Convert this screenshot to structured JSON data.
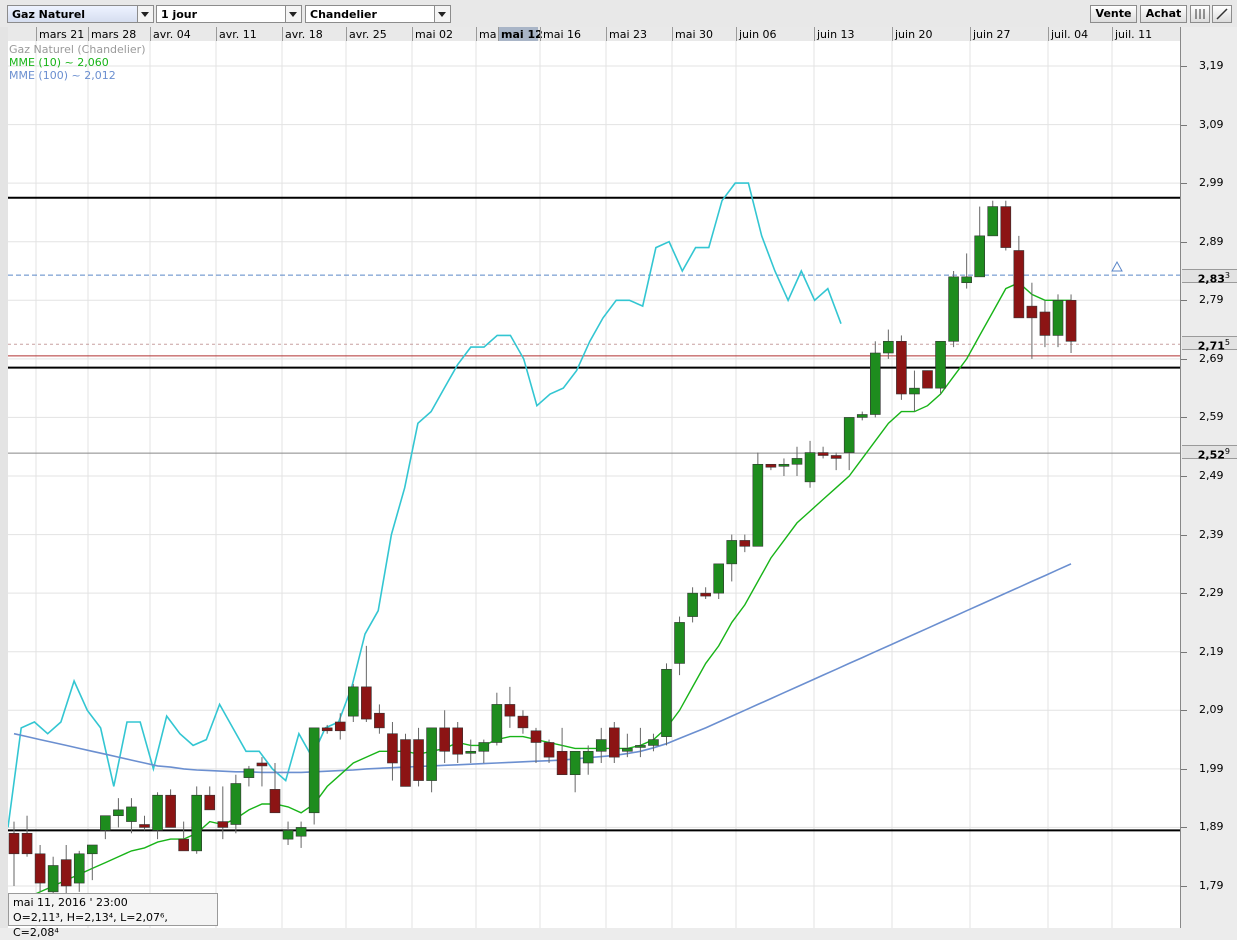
{
  "toolbar": {
    "instrument": "Gaz Naturel",
    "period": "1 jour",
    "chart_type": "Chandelier",
    "sell_label": "Vente",
    "buy_label": "Achat"
  },
  "date_labels": [
    "mars 21",
    "mars 28",
    "avr. 04",
    "avr. 11",
    "avr. 18",
    "avr. 25",
    "mai 02",
    "ma",
    "mai 12",
    "mai 16",
    "mai 23",
    "mai 30",
    "juin 06",
    "juin 13",
    "juin 20",
    "juin 27",
    "juil. 04",
    "juil. 11"
  ],
  "legend": {
    "title": "Gaz Naturel (Chandelier)",
    "ema10": "MME (10) ~ 2,060",
    "ema100": "MME (100) ~ 2,012"
  },
  "price_boxes": {
    "upper": "2,83",
    "upper_frac": "3",
    "current": "2,71",
    "current_frac": "5",
    "lower": "2,52",
    "lower_frac": "9"
  },
  "info": {
    "date": "mai 11, 2016 ' 23:00",
    "ohlc": "O=2,11³, H=2,13⁴, L=2,07⁶, C=2,08⁴"
  },
  "colors": {
    "up": "#1e8c1e",
    "down": "#8c1414",
    "ema10": "#18b418",
    "ema100": "#6b8fd0",
    "oscillator": "#33c6d2"
  },
  "chart_data": {
    "type": "candlestick",
    "title": "Gaz Naturel (Chandelier)",
    "ylim": [
      1.75,
      3.24
    ],
    "y_ticks": [
      3.19,
      3.09,
      2.99,
      2.89,
      2.79,
      2.69,
      2.59,
      2.49,
      2.39,
      2.29,
      2.19,
      2.09,
      1.99,
      1.89,
      1.79
    ],
    "y_tick_labels": [
      "3,19",
      "3,09",
      "2,99",
      "2,89",
      "2,79",
      "2,69",
      "2,59",
      "2,49",
      "2,39",
      "2,29",
      "2,19",
      "2,09",
      "1,99",
      "1,89",
      "1,79"
    ],
    "horizontal_lines": [
      2.965,
      2.675,
      1.885
    ],
    "dashed_line": 2.833,
    "candles": [
      {
        "o": 1.88,
        "h": 1.9,
        "l": 1.79,
        "c": 1.845
      },
      {
        "o": 1.88,
        "h": 1.91,
        "l": 1.84,
        "c": 1.845
      },
      {
        "o": 1.845,
        "h": 1.86,
        "l": 1.78,
        "c": 1.795
      },
      {
        "o": 1.78,
        "h": 1.84,
        "l": 1.765,
        "c": 1.825
      },
      {
        "o": 1.835,
        "h": 1.86,
        "l": 1.77,
        "c": 1.79
      },
      {
        "o": 1.795,
        "h": 1.85,
        "l": 1.78,
        "c": 1.845
      },
      {
        "o": 1.845,
        "h": 1.86,
        "l": 1.8,
        "c": 1.86
      },
      {
        "o": 1.885,
        "h": 1.91,
        "l": 1.87,
        "c": 1.91
      },
      {
        "o": 1.91,
        "h": 1.94,
        "l": 1.89,
        "c": 1.92
      },
      {
        "o": 1.9,
        "h": 1.94,
        "l": 1.88,
        "c": 1.925
      },
      {
        "o": 1.895,
        "h": 1.91,
        "l": 1.885,
        "c": 1.89
      },
      {
        "o": 1.885,
        "h": 1.95,
        "l": 1.87,
        "c": 1.945
      },
      {
        "o": 1.945,
        "h": 1.955,
        "l": 1.9,
        "c": 1.89
      },
      {
        "o": 1.87,
        "h": 1.9,
        "l": 1.855,
        "c": 1.85
      },
      {
        "o": 1.85,
        "h": 1.96,
        "l": 1.845,
        "c": 1.945
      },
      {
        "o": 1.945,
        "h": 1.96,
        "l": 1.93,
        "c": 1.92
      },
      {
        "o": 1.9,
        "h": 1.96,
        "l": 1.87,
        "c": 1.89
      },
      {
        "o": 1.895,
        "h": 1.98,
        "l": 1.88,
        "c": 1.965
      },
      {
        "o": 1.975,
        "h": 1.995,
        "l": 1.96,
        "c": 1.99
      },
      {
        "o": 2.0,
        "h": 2.01,
        "l": 1.96,
        "c": 1.995
      },
      {
        "o": 1.955,
        "h": 2.0,
        "l": 1.92,
        "c": 1.915
      },
      {
        "o": 1.87,
        "h": 1.9,
        "l": 1.86,
        "c": 1.885
      },
      {
        "o": 1.875,
        "h": 1.9,
        "l": 1.855,
        "c": 1.89
      },
      {
        "o": 1.915,
        "h": 2.005,
        "l": 1.895,
        "c": 2.06
      },
      {
        "o": 2.06,
        "h": 2.065,
        "l": 2.05,
        "c": 2.055
      },
      {
        "o": 2.07,
        "h": 2.085,
        "l": 2.04,
        "c": 2.055
      },
      {
        "o": 2.08,
        "h": 2.135,
        "l": 2.07,
        "c": 2.13
      },
      {
        "o": 2.13,
        "h": 2.2,
        "l": 2.07,
        "c": 2.075
      },
      {
        "o": 2.085,
        "h": 2.1,
        "l": 2.05,
        "c": 2.06
      },
      {
        "o": 2.05,
        "h": 2.07,
        "l": 1.97,
        "c": 2.0
      },
      {
        "o": 2.04,
        "h": 2.05,
        "l": 1.96,
        "c": 1.96
      },
      {
        "o": 2.04,
        "h": 2.06,
        "l": 1.96,
        "c": 1.97
      },
      {
        "o": 1.97,
        "h": 2.04,
        "l": 1.95,
        "c": 2.06
      },
      {
        "o": 2.06,
        "h": 2.09,
        "l": 2.0,
        "c": 2.02
      },
      {
        "o": 2.06,
        "h": 2.07,
        "l": 2.0,
        "c": 2.015
      },
      {
        "o": 2.02,
        "h": 2.04,
        "l": 2.0,
        "c": 2.02
      },
      {
        "o": 2.02,
        "h": 2.04,
        "l": 2.0,
        "c": 2.035
      },
      {
        "o": 2.035,
        "h": 2.12,
        "l": 2.03,
        "c": 2.1
      },
      {
        "o": 2.1,
        "h": 2.13,
        "l": 2.06,
        "c": 2.08
      },
      {
        "o": 2.08,
        "h": 2.09,
        "l": 2.05,
        "c": 2.06
      },
      {
        "o": 2.055,
        "h": 2.06,
        "l": 2.0,
        "c": 2.035
      },
      {
        "o": 2.035,
        "h": 2.04,
        "l": 2.0,
        "c": 2.01
      },
      {
        "o": 2.02,
        "h": 2.06,
        "l": 1.99,
        "c": 1.98
      },
      {
        "o": 1.98,
        "h": 2.02,
        "l": 1.95,
        "c": 2.02
      },
      {
        "o": 2.0,
        "h": 2.03,
        "l": 1.98,
        "c": 2.02
      },
      {
        "o": 2.02,
        "h": 2.06,
        "l": 2.0,
        "c": 2.04
      },
      {
        "o": 2.06,
        "h": 2.07,
        "l": 2.0,
        "c": 2.01
      },
      {
        "o": 2.02,
        "h": 2.05,
        "l": 2.01,
        "c": 2.025
      },
      {
        "o": 2.03,
        "h": 2.06,
        "l": 2.01,
        "c": 2.03
      },
      {
        "o": 2.03,
        "h": 2.05,
        "l": 2.02,
        "c": 2.04
      },
      {
        "o": 2.045,
        "h": 2.17,
        "l": 2.03,
        "c": 2.16
      },
      {
        "o": 2.17,
        "h": 2.25,
        "l": 2.15,
        "c": 2.24
      },
      {
        "o": 2.25,
        "h": 2.3,
        "l": 2.24,
        "c": 2.29
      },
      {
        "o": 2.29,
        "h": 2.3,
        "l": 2.28,
        "c": 2.285
      },
      {
        "o": 2.29,
        "h": 2.34,
        "l": 2.28,
        "c": 2.34
      },
      {
        "o": 2.34,
        "h": 2.39,
        "l": 2.31,
        "c": 2.38
      },
      {
        "o": 2.38,
        "h": 2.39,
        "l": 2.36,
        "c": 2.37
      },
      {
        "o": 2.37,
        "h": 2.53,
        "l": 2.37,
        "c": 2.51
      },
      {
        "o": 2.51,
        "h": 2.51,
        "l": 2.5,
        "c": 2.505
      },
      {
        "o": 2.51,
        "h": 2.52,
        "l": 2.49,
        "c": 2.51
      },
      {
        "o": 2.51,
        "h": 2.54,
        "l": 2.49,
        "c": 2.52
      },
      {
        "o": 2.48,
        "h": 2.55,
        "l": 2.47,
        "c": 2.53
      },
      {
        "o": 2.53,
        "h": 2.54,
        "l": 2.52,
        "c": 2.525
      },
      {
        "o": 2.525,
        "h": 2.53,
        "l": 2.5,
        "c": 2.52
      },
      {
        "o": 2.53,
        "h": 2.59,
        "l": 2.5,
        "c": 2.59
      },
      {
        "o": 2.59,
        "h": 2.6,
        "l": 2.585,
        "c": 2.595
      },
      {
        "o": 2.595,
        "h": 2.72,
        "l": 2.59,
        "c": 2.7
      },
      {
        "o": 2.7,
        "h": 2.74,
        "l": 2.69,
        "c": 2.72
      },
      {
        "o": 2.72,
        "h": 2.73,
        "l": 2.62,
        "c": 2.63
      },
      {
        "o": 2.63,
        "h": 2.67,
        "l": 2.6,
        "c": 2.64
      },
      {
        "o": 2.67,
        "h": 2.67,
        "l": 2.64,
        "c": 2.64
      },
      {
        "o": 2.64,
        "h": 2.72,
        "l": 2.63,
        "c": 2.72
      },
      {
        "o": 2.72,
        "h": 2.84,
        "l": 2.71,
        "c": 2.83
      },
      {
        "o": 2.82,
        "h": 2.87,
        "l": 2.81,
        "c": 2.83
      },
      {
        "o": 2.83,
        "h": 2.95,
        "l": 2.83,
        "c": 2.9
      },
      {
        "o": 2.9,
        "h": 2.96,
        "l": 2.9,
        "c": 2.95
      },
      {
        "o": 2.95,
        "h": 2.96,
        "l": 2.875,
        "c": 2.88
      },
      {
        "o": 2.875,
        "h": 2.9,
        "l": 2.78,
        "c": 2.76
      },
      {
        "o": 2.78,
        "h": 2.82,
        "l": 2.69,
        "c": 2.76
      },
      {
        "o": 2.77,
        "h": 2.79,
        "l": 2.71,
        "c": 2.73
      },
      {
        "o": 2.73,
        "h": 2.8,
        "l": 2.71,
        "c": 2.79
      },
      {
        "o": 2.79,
        "h": 2.8,
        "l": 2.7,
        "c": 2.72
      }
    ],
    "ema10": [
      1.76,
      1.77,
      1.78,
      1.79,
      1.8,
      1.81,
      1.82,
      1.83,
      1.84,
      1.85,
      1.855,
      1.865,
      1.87,
      1.87,
      1.88,
      1.9,
      1.895,
      1.905,
      1.92,
      1.93,
      1.93,
      1.925,
      1.915,
      1.93,
      1.96,
      1.98,
      2.0,
      2.01,
      2.02,
      2.02,
      2.02,
      2.015,
      2.02,
      2.025,
      2.035,
      2.03,
      2.03,
      2.04,
      2.045,
      2.045,
      2.04,
      2.035,
      2.03,
      2.025,
      2.025,
      2.025,
      2.025,
      2.025,
      2.03,
      2.04,
      2.06,
      2.09,
      2.13,
      2.17,
      2.2,
      2.24,
      2.27,
      2.31,
      2.35,
      2.38,
      2.41,
      2.43,
      2.45,
      2.47,
      2.49,
      2.52,
      2.55,
      2.58,
      2.6,
      2.6,
      2.61,
      2.63,
      2.66,
      2.69,
      2.73,
      2.77,
      2.81,
      2.82,
      2.8,
      2.79,
      2.79,
      2.79
    ],
    "ema100": [
      2.05,
      2.045,
      2.04,
      2.035,
      2.03,
      2.025,
      2.02,
      2.015,
      2.01,
      2.005,
      2.0,
      1.995,
      1.993,
      1.99,
      1.988,
      1.987,
      1.986,
      1.985,
      1.985,
      1.984,
      1.984,
      1.984,
      1.984,
      1.985,
      1.986,
      1.987,
      1.988,
      1.99,
      1.991,
      1.992,
      1.993,
      1.994,
      1.995,
      1.996,
      1.997,
      1.998,
      1.999,
      2.0,
      2.001,
      2.002,
      2.003,
      2.004,
      2.005,
      2.007,
      2.009,
      2.011,
      2.013,
      2.016,
      2.02,
      2.026,
      2.033,
      2.042,
      2.051,
      2.06,
      2.07,
      2.08,
      2.09,
      2.1,
      2.11,
      2.12,
      2.13,
      2.14,
      2.15,
      2.16,
      2.17,
      2.18,
      2.19,
      2.2,
      2.21,
      2.22,
      2.23,
      2.24,
      2.25,
      2.26,
      2.27,
      2.28,
      2.29,
      2.3,
      2.31,
      2.32,
      2.33,
      2.34
    ],
    "oscillator": [
      1.89,
      2.06,
      2.07,
      2.05,
      2.07,
      2.14,
      2.09,
      2.06,
      1.96,
      2.07,
      2.07,
      1.99,
      2.08,
      2.05,
      2.03,
      2.04,
      2.1,
      2.06,
      2.02,
      2.02,
      1.99,
      1.97,
      2.05,
      2.01,
      2.06,
      2.07,
      2.13,
      2.22,
      2.26,
      2.39,
      2.47,
      2.58,
      2.6,
      2.64,
      2.68,
      2.71,
      2.71,
      2.73,
      2.73,
      2.69,
      2.61,
      2.63,
      2.64,
      2.67,
      2.72,
      2.76,
      2.79,
      2.79,
      2.78,
      2.88,
      2.89,
      2.84,
      2.88,
      2.88,
      2.96,
      2.99,
      2.99,
      2.9,
      2.84,
      2.79,
      2.84,
      2.79,
      2.81,
      2.75
    ]
  }
}
